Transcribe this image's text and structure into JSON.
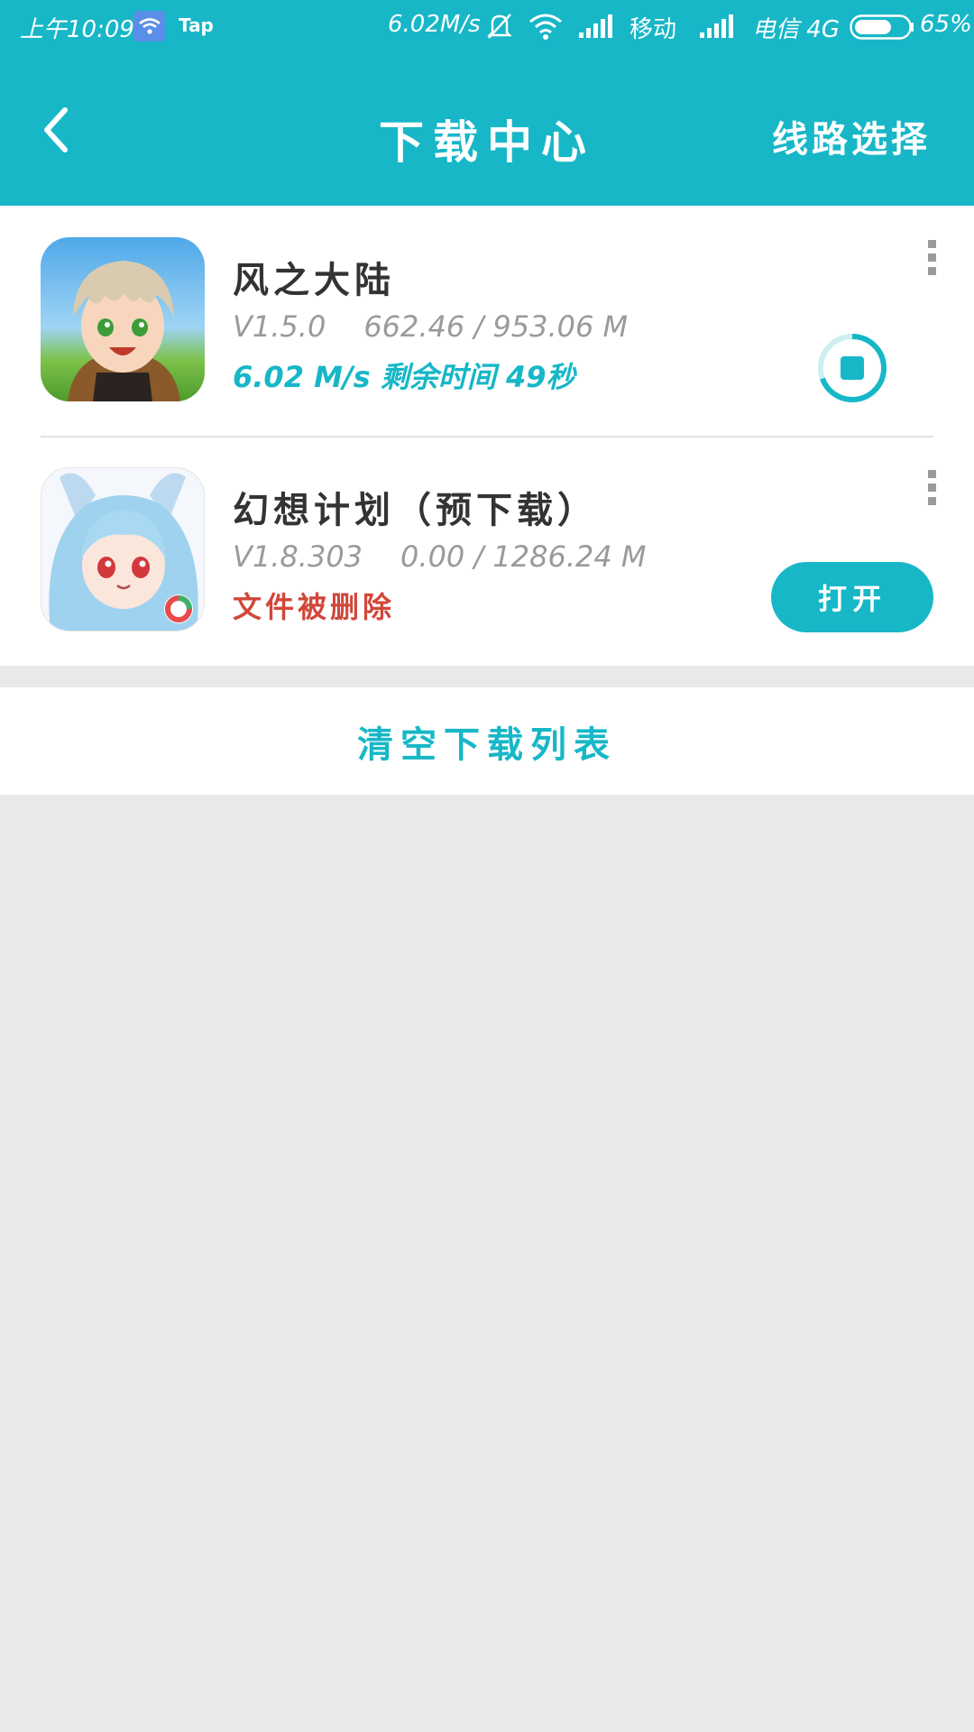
{
  "status_bar": {
    "time": "上午10:09",
    "app_badge": "Tap",
    "net_speed": "6.02M/s",
    "carrier1": "移动",
    "carrier2": "电信 4G",
    "battery": "65%"
  },
  "header": {
    "title": "下载中心",
    "action_label": "线路选择"
  },
  "downloads": [
    {
      "name": "风之大陆",
      "version": "V1.5.0",
      "size": "662.46 / 953.06 M",
      "status": "6.02 M/s  剩余时间 49秒",
      "action": "stop",
      "progress": 0.695
    },
    {
      "name": "幻想计划（预下载）",
      "version": "V1.8.303",
      "size": "0.00 / 1286.24 M",
      "status": "文件被删除",
      "action_label": "打开"
    }
  ],
  "footer": {
    "clear_label": "清空下载列表"
  },
  "colors": {
    "accent": "#17b7c7",
    "error": "#d1473a",
    "background": "#e9e9e9"
  }
}
